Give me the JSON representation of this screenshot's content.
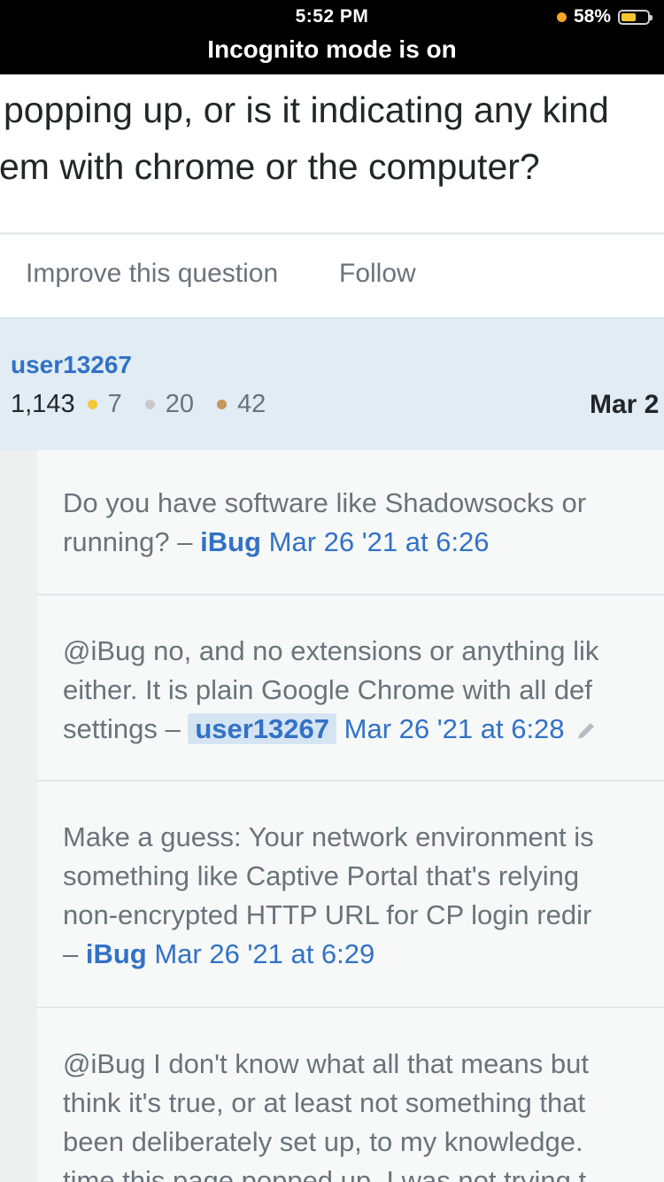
{
  "status_bar": {
    "time": "5:52 PM",
    "battery_percent": "58%",
    "battery_level": 0.58,
    "banner": "Incognito mode is on"
  },
  "question": {
    "lines": [
      "popping up, or is it indicating any kind",
      "em with chrome or the computer?"
    ],
    "actions": {
      "improve": "Improve this question",
      "follow": "Follow"
    }
  },
  "owner": {
    "name": "user13267",
    "reputation": "1,143",
    "gold": "7",
    "silver": "20",
    "bronze": "42",
    "date": "Mar 2",
    "badge_colors": {
      "gold": "#f5c83b",
      "silver": "#c9c9c9",
      "bronze": "#c8965f"
    }
  },
  "comments": [
    {
      "lines": [
        "Do you have software like Shadowsocks or",
        "running? – "
      ],
      "user": "iBug",
      "date": "Mar 26 '21 at 6:26"
    },
    {
      "lines": [
        "@iBug no, and no extensions or anything lik",
        "either. It is plain Google Chrome with all def",
        "settings – "
      ],
      "user": "user13267",
      "date": "Mar 26 '21 at 6:28"
    },
    {
      "lines": [
        "Make a guess: Your network environment is",
        "something like Captive Portal that's relying",
        "non-encrypted HTTP URL for CP login redir",
        "– "
      ],
      "user": "iBug",
      "date": "Mar 26 '21 at 6:29"
    },
    {
      "lines": [
        "@iBug I don't know what all that means but",
        "think it's true, or at least not something that",
        "been deliberately set up, to my knowledge.",
        "time this page popped up, I was not trying t"
      ]
    }
  ]
}
